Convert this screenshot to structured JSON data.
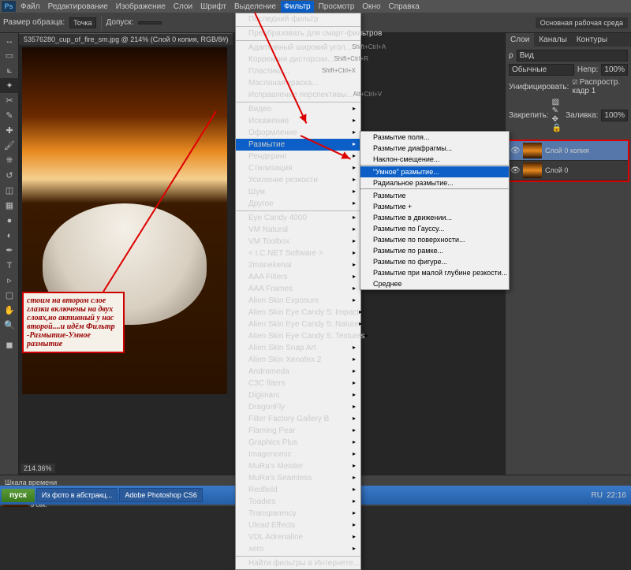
{
  "menubar": {
    "logo": "Ps",
    "items": [
      "Файл",
      "Редактирование",
      "Изображение",
      "Слои",
      "Шрифт",
      "Выделение",
      "Фильтр",
      "Просмотр",
      "Окно",
      "Справка"
    ],
    "activeIndex": 6
  },
  "optionsbar": {
    "sample_label": "Размер образца:",
    "sample_value": "Точка",
    "tolerance_label": "Допуск:",
    "tolerance_value": "",
    "workspace": "Основная рабочая среда"
  },
  "doc_tab": "53576280_cup_of_fire_sm.jpg @ 214% (Слой 0 копия, RGB/8#)",
  "zoom": "214.36%",
  "note_text": "стоим на втором слое  глазки включены на двух слоях,но активный у нас второй....и идём Фильтр -Размытие-Умное размытие",
  "filter_menu": {
    "top": [
      {
        "t": "Последний фильтр",
        "d": true
      }
    ],
    "g1": [
      {
        "t": "Преобразовать для смарт-фильтров"
      }
    ],
    "g2": [
      {
        "t": "Адаптивный широкий угол...",
        "s": "Shift+Ctrl+A"
      },
      {
        "t": "Коррекция дисторсии...",
        "s": "Shift+Ctrl+R"
      },
      {
        "t": "Пластика...",
        "s": "Shift+Ctrl+X"
      },
      {
        "t": "Масляная краска..."
      },
      {
        "t": "Исправление перспективы...",
        "s": "Alt+Ctrl+V"
      }
    ],
    "g3": [
      {
        "t": "Видео",
        "a": true
      },
      {
        "t": "Искажение",
        "a": true
      },
      {
        "t": "Оформление",
        "a": true
      },
      {
        "t": "Размытие",
        "a": true,
        "hl": true
      },
      {
        "t": "Рендеринг",
        "a": true
      },
      {
        "t": "Стилизация",
        "a": true
      },
      {
        "t": "Усиление резкости",
        "a": true
      },
      {
        "t": "Шум",
        "a": true
      },
      {
        "t": "Другое",
        "a": true
      }
    ],
    "g4": [
      {
        "t": "Eye Candy 4000",
        "a": true
      },
      {
        "t": "VM Natural",
        "a": true
      },
      {
        "t": "VM Toolbox",
        "a": true
      },
      {
        "t": "< I.C.NET Software >",
        "a": true
      },
      {
        "t": "2manekenai",
        "a": true
      },
      {
        "t": "AAA Filters",
        "a": true
      },
      {
        "t": "AAA Frames",
        "a": true
      },
      {
        "t": "Alien Skin Exposure",
        "a": true
      },
      {
        "t": "Alien Skin Eye Candy 5: Impact",
        "a": true
      },
      {
        "t": "Alien Skin Eye Candy 5: Nature",
        "a": true
      },
      {
        "t": "Alien Skin Eye Candy 5: Textures",
        "a": true
      },
      {
        "t": "Alien Skin Snap Art",
        "a": true
      },
      {
        "t": "Alien Skin Xenofex 2",
        "a": true
      },
      {
        "t": "Andromeda",
        "a": true
      },
      {
        "t": "C3C filters",
        "a": true
      },
      {
        "t": "Digimarc",
        "a": true
      },
      {
        "t": "DragonFly",
        "a": true
      },
      {
        "t": "Filter Factory Gallery B",
        "a": true
      },
      {
        "t": "Flaming Pear",
        "a": true
      },
      {
        "t": "Graphics Plus",
        "a": true
      },
      {
        "t": "Imagenomic",
        "a": true
      },
      {
        "t": "MuRa's Meister",
        "a": true
      },
      {
        "t": "MuRa's Seamless",
        "a": true
      },
      {
        "t": "Redfield",
        "a": true
      },
      {
        "t": "Toadies",
        "a": true
      },
      {
        "t": "Transparency",
        "a": true
      },
      {
        "t": "Ulead Effects",
        "a": true
      },
      {
        "t": "VDL Adrenaline",
        "a": true
      },
      {
        "t": "xero",
        "a": true
      }
    ],
    "g5": [
      {
        "t": "Найти фильтры в Интернете..."
      }
    ]
  },
  "blur_submenu": [
    "Размытие поля...",
    "Размытие диафрагмы...",
    "Наклон-смещение...",
    "\"Умное\" размытие...",
    "Радиальное размытие...",
    "Размытие",
    "Размытие +",
    "Размытие в движении...",
    "Размытие по Гауссу...",
    "Размытие по поверхности...",
    "Размытие по рамке...",
    "Размытие по фигуре...",
    "Размытие при малой глубине резкости...",
    "Среднее"
  ],
  "blur_hl_index": 3,
  "layers_panel": {
    "tabs": [
      "Слои",
      "Каналы",
      "Контуры"
    ],
    "kind": "Вид",
    "blend": "Обычные",
    "opacity_label": "Непр:",
    "opacity": "100%",
    "lock_label": "Закрепить:",
    "fill_label": "Заливка:",
    "fill": "100%",
    "unify": "Унифицировать:",
    "propagate": "Распростр. кадр 1",
    "layers": [
      {
        "name": "Слой 0 копия",
        "sel": true
      },
      {
        "name": "Слой 0",
        "sel": false
      }
    ]
  },
  "timeline": {
    "title": "Шкала времени",
    "duration": "5 сек."
  },
  "taskbar": {
    "start": "пуск",
    "tasks": [
      "Из фото в абстракц...",
      "Adobe Photoshop CS6"
    ],
    "lang": "RU",
    "time": "22:16"
  }
}
